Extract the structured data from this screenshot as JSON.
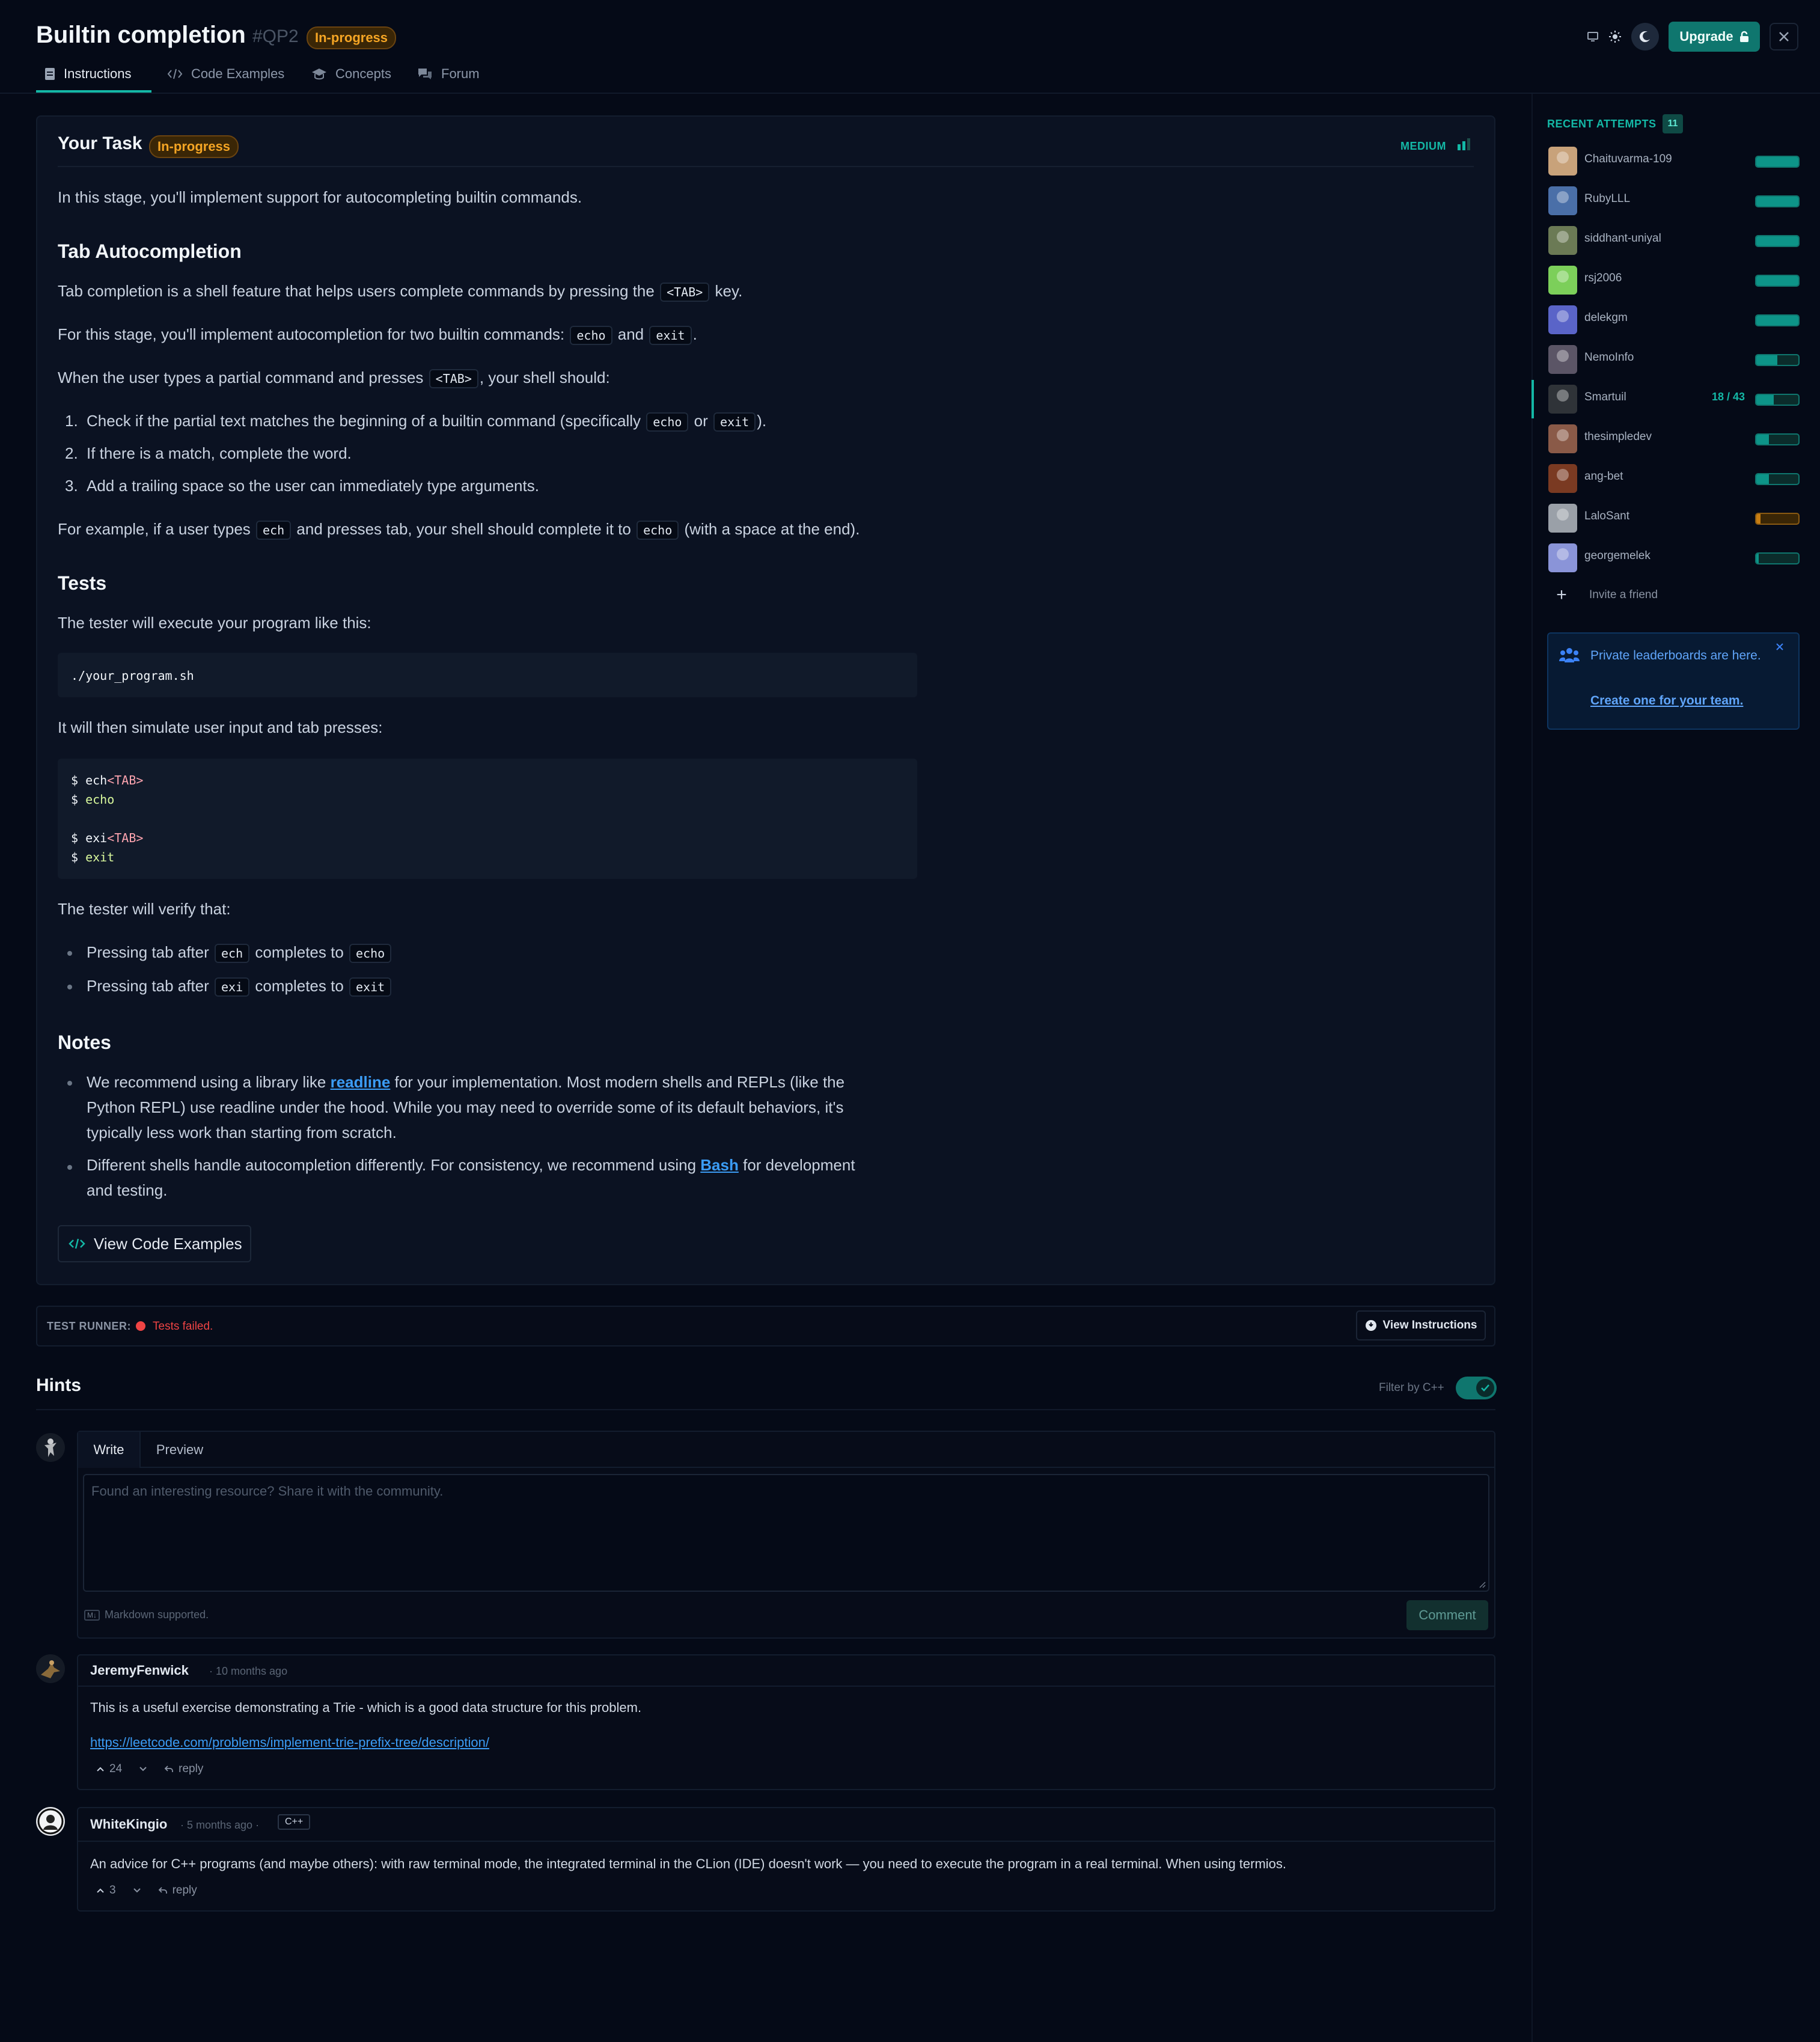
{
  "header": {
    "title": "Builtin completion",
    "id": "#QP2",
    "status": "In-progress",
    "tabs": [
      {
        "label": "Instructions"
      },
      {
        "label": "Code Examples"
      },
      {
        "label": "Concepts"
      },
      {
        "label": "Forum"
      }
    ],
    "upgrade_label": "Upgrade"
  },
  "task": {
    "title": "Your Task",
    "status": "In-progress",
    "difficulty": "MEDIUM",
    "intro": "In this stage, you'll implement support for autocompleting builtin commands.",
    "section1_title": "Tab Autocompletion",
    "p1_a": "Tab completion is a shell feature that helps users complete commands by pressing the",
    "p1_code": "<TAB>",
    "p1_b": "key.",
    "p2_a": "For this stage, you'll implement autocompletion for two builtin commands:",
    "p2_code1": "echo",
    "p2_and": "and",
    "p2_code2": "exit",
    "p2_end": ".",
    "p3_a": "When the user types a partial command and presses",
    "p3_code": "<TAB>",
    "p3_b": ", your shell should:",
    "steps": [
      {
        "num": "1.",
        "a": "Check if the partial text matches the beginning of a builtin command (specifically",
        "c1": "echo",
        "or": "or",
        "c2": "exit",
        "end": ")."
      },
      {
        "num": "2.",
        "text": "If there is a match, complete the word."
      },
      {
        "num": "3.",
        "text": "Add a trailing space so the user can immediately type arguments."
      }
    ],
    "p4_a": "For example, if a user types",
    "p4_code1": "ech",
    "p4_b": "and presses tab, your shell should complete it to",
    "p4_code2": "echo",
    "p4_c": "(with a space at the end).",
    "section2_title": "Tests",
    "p5": "The tester will execute your program like this:",
    "code1": "./your_program.sh",
    "p6": "It will then simulate user input and tab presses:",
    "code2_l1_prompt": "$ ",
    "code2_l1_cmd": "ech",
    "code2_l1_tab": "<TAB>",
    "code2_l2_prompt": "$ ",
    "code2_l2_cmd": "echo",
    "code2_l3_prompt": "$ ",
    "code2_l3_cmd": "exi",
    "code2_l3_tab": "<TAB>",
    "code2_l4_prompt": "$ ",
    "code2_l4_cmd": "exit",
    "p7": "The tester will verify that:",
    "verify": [
      {
        "a": "Pressing tab after",
        "c1": "ech",
        "b": "completes to",
        "c2": "echo"
      },
      {
        "a": "Pressing tab after",
        "c1": "exi",
        "b": "completes to",
        "c2": "exit"
      }
    ],
    "section3_title": "Notes",
    "note1_a": "We recommend using a library like",
    "note1_link": "readline",
    "note1_b": "for your implementation. Most modern shells and REPLs (like the",
    "note1_l2": "Python REPL) use readline under the hood. While you may need to override some of its default behaviors, it's",
    "note1_l3": "typically less work than starting from scratch.",
    "note2_a": "Different shells handle autocompletion differently. For consistency, we recommend using",
    "note2_link": "Bash",
    "note2_b": "for development",
    "note2_l2": "and testing.",
    "view_code_label": "View Code Examples"
  },
  "runner": {
    "label": "TEST RUNNER:",
    "status": "Tests failed.",
    "view_instructions": "View Instructions"
  },
  "hints": {
    "title": "Hints",
    "filter_label": "Filter by C++",
    "editor": {
      "tab_write": "Write",
      "tab_preview": "Preview",
      "placeholder": "Found an interesting resource? Share it with the community.",
      "md_badge": "M↓",
      "md_note": "Markdown supported.",
      "submit": "Comment"
    },
    "comments": [
      {
        "author": "JeremyFenwick",
        "time": "10 months ago",
        "body": "This is a useful exercise demonstrating a Trie - which is a good data structure for this problem.",
        "link": "https://leetcode.com/problems/implement-trie-prefix-tree/description/",
        "upvotes": "24",
        "reply": "reply"
      },
      {
        "author": "WhiteKingio",
        "time": "5 months ago",
        "lang": "C++",
        "body": "An advice for C++ programs (and maybe others): with raw terminal mode, the integrated terminal in the CLion (IDE) doesn't work — you need to execute the program in a real terminal. When using termios.",
        "upvotes": "3",
        "reply": "reply"
      }
    ]
  },
  "sidebar": {
    "recent_title": "RECENT ATTEMPTS",
    "recent_count": "11",
    "attempts": [
      {
        "name": "Chaituvarma-109",
        "progress": 1.0,
        "color": "#0d9488",
        "avatar": "#c8a27a"
      },
      {
        "name": "RubyLLL",
        "progress": 1.0,
        "color": "#0d9488",
        "avatar": "#4a6fa8"
      },
      {
        "name": "siddhant-uniyal",
        "progress": 1.0,
        "color": "#0d9488",
        "avatar": "#6b7a55"
      },
      {
        "name": "rsj2006",
        "progress": 1.0,
        "color": "#0d9488",
        "avatar": "#7ccf5a"
      },
      {
        "name": "delekgm",
        "progress": 1.0,
        "color": "#0d9488",
        "avatar": "#5a64c8"
      },
      {
        "name": "NemoInfo",
        "progress": 0.5,
        "color": "#0d9488",
        "avatar": "#5b5566"
      },
      {
        "name": "Smartuil",
        "progress": 0.42,
        "color": "#0d9488",
        "avatar": "#2f3338",
        "score": "18 / 43"
      },
      {
        "name": "thesimpledev",
        "progress": 0.3,
        "color": "#0d9488",
        "avatar": "#8a5a48"
      },
      {
        "name": "ang-bet",
        "progress": 0.3,
        "color": "#0d9488",
        "avatar": "#7a3a22"
      },
      {
        "name": "LaloSant",
        "progress": 0.1,
        "color": "#c77d12",
        "avatar": "#9aa0a8"
      },
      {
        "name": "georgemelek",
        "progress": 0.05,
        "color": "#0d9488",
        "avatar": "#8a94d8"
      }
    ],
    "invite_label": "Invite a friend",
    "promo_text": "Private leaderboards are here.",
    "promo_link": "Create one for your team."
  }
}
